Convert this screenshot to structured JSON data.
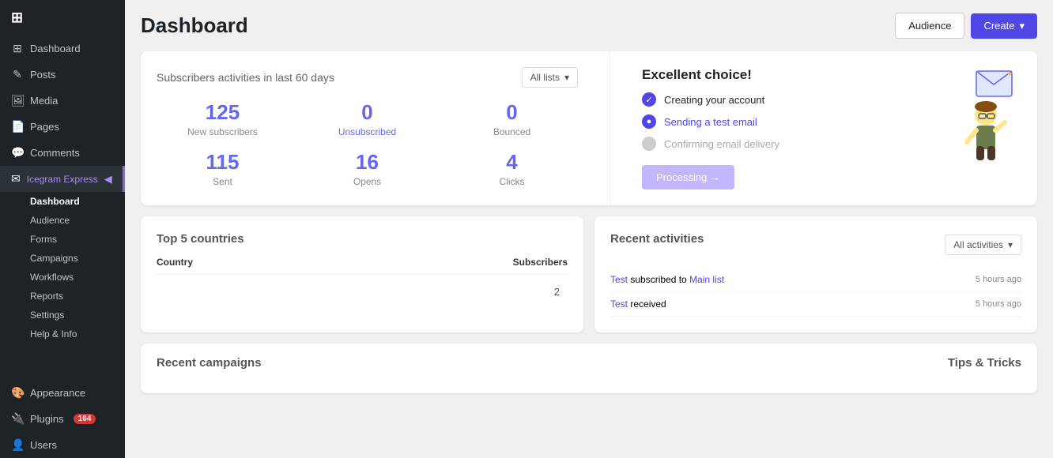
{
  "sidebar": {
    "logo": {
      "icon": "⊞",
      "label": ""
    },
    "items": [
      {
        "id": "dashboard-wp",
        "icon": "⊞",
        "label": "Dashboard"
      },
      {
        "id": "posts",
        "icon": "✎",
        "label": "Posts"
      },
      {
        "id": "media",
        "icon": "🖼",
        "label": "Media"
      },
      {
        "id": "pages",
        "icon": "📄",
        "label": "Pages"
      },
      {
        "id": "comments",
        "icon": "💬",
        "label": "Comments"
      },
      {
        "id": "icegram",
        "icon": "✉",
        "label": "Icegram Express"
      }
    ],
    "sub_items": [
      {
        "id": "sub-dashboard",
        "label": "Dashboard",
        "active": true
      },
      {
        "id": "sub-audience",
        "label": "Audience"
      },
      {
        "id": "sub-forms",
        "label": "Forms"
      },
      {
        "id": "sub-campaigns",
        "label": "Campaigns"
      },
      {
        "id": "sub-workflows",
        "label": "Workflows"
      },
      {
        "id": "sub-reports",
        "label": "Reports"
      },
      {
        "id": "sub-settings",
        "label": "Settings"
      },
      {
        "id": "sub-help",
        "label": "Help & Info"
      }
    ],
    "bottom_items": [
      {
        "id": "appearance",
        "icon": "🎨",
        "label": "Appearance"
      },
      {
        "id": "plugins",
        "icon": "🔌",
        "label": "Plugins",
        "badge": "164"
      },
      {
        "id": "users",
        "icon": "👤",
        "label": "Users"
      }
    ]
  },
  "header": {
    "title": "Dashboard",
    "audience_btn": "Audience",
    "create_btn": "Create"
  },
  "subscribers_card": {
    "title": "Subscribers activities in last 60 days",
    "dropdown_label": "All lists",
    "stats": [
      {
        "id": "new-subs",
        "number": "125",
        "label": "New subscribers",
        "is_link": false
      },
      {
        "id": "unsubscribed",
        "number": "0",
        "label": "Unsubscribed",
        "is_link": true
      },
      {
        "id": "bounced",
        "number": "0",
        "label": "Bounced",
        "is_link": false
      }
    ],
    "stats2": [
      {
        "id": "sent",
        "number": "115",
        "label": "Sent",
        "is_link": false
      },
      {
        "id": "opens",
        "number": "16",
        "label": "Opens",
        "is_link": false
      },
      {
        "id": "clicks",
        "number": "4",
        "label": "Clicks",
        "is_link": false
      }
    ]
  },
  "excellent_card": {
    "title": "Excellent choice!",
    "checklist": [
      {
        "id": "creating-account",
        "text": "Creating your account",
        "status": "done"
      },
      {
        "id": "test-email",
        "text": "Sending a test email",
        "status": "progress"
      },
      {
        "id": "confirm-delivery",
        "text": "Confirming email delivery",
        "status": "pending"
      }
    ],
    "processing_btn": "Processing →"
  },
  "countries_card": {
    "title": "Top 5 countries",
    "col_country": "Country",
    "col_subscribers": "Subscribers",
    "rows": [
      {
        "country": "",
        "count": "2"
      }
    ]
  },
  "activities_card": {
    "title": "Recent activities",
    "dropdown_label": "All activities",
    "items": [
      {
        "id": "act-1",
        "prefix": "",
        "link1": "Test",
        "middle": " subscribed to ",
        "link2": "Main list",
        "time": "5 hours ago"
      },
      {
        "id": "act-2",
        "prefix": "",
        "link1": "Test",
        "middle": " received",
        "link2": "",
        "time": "5 hours ago"
      }
    ]
  },
  "recent_campaigns": {
    "title": "Recent campaigns",
    "tips_title": "Tips & Tricks"
  },
  "colors": {
    "accent": "#4f46e5",
    "accent_light": "#c4b5fd",
    "sidebar_bg": "#1d2327",
    "sidebar_active": "#2c3338"
  }
}
